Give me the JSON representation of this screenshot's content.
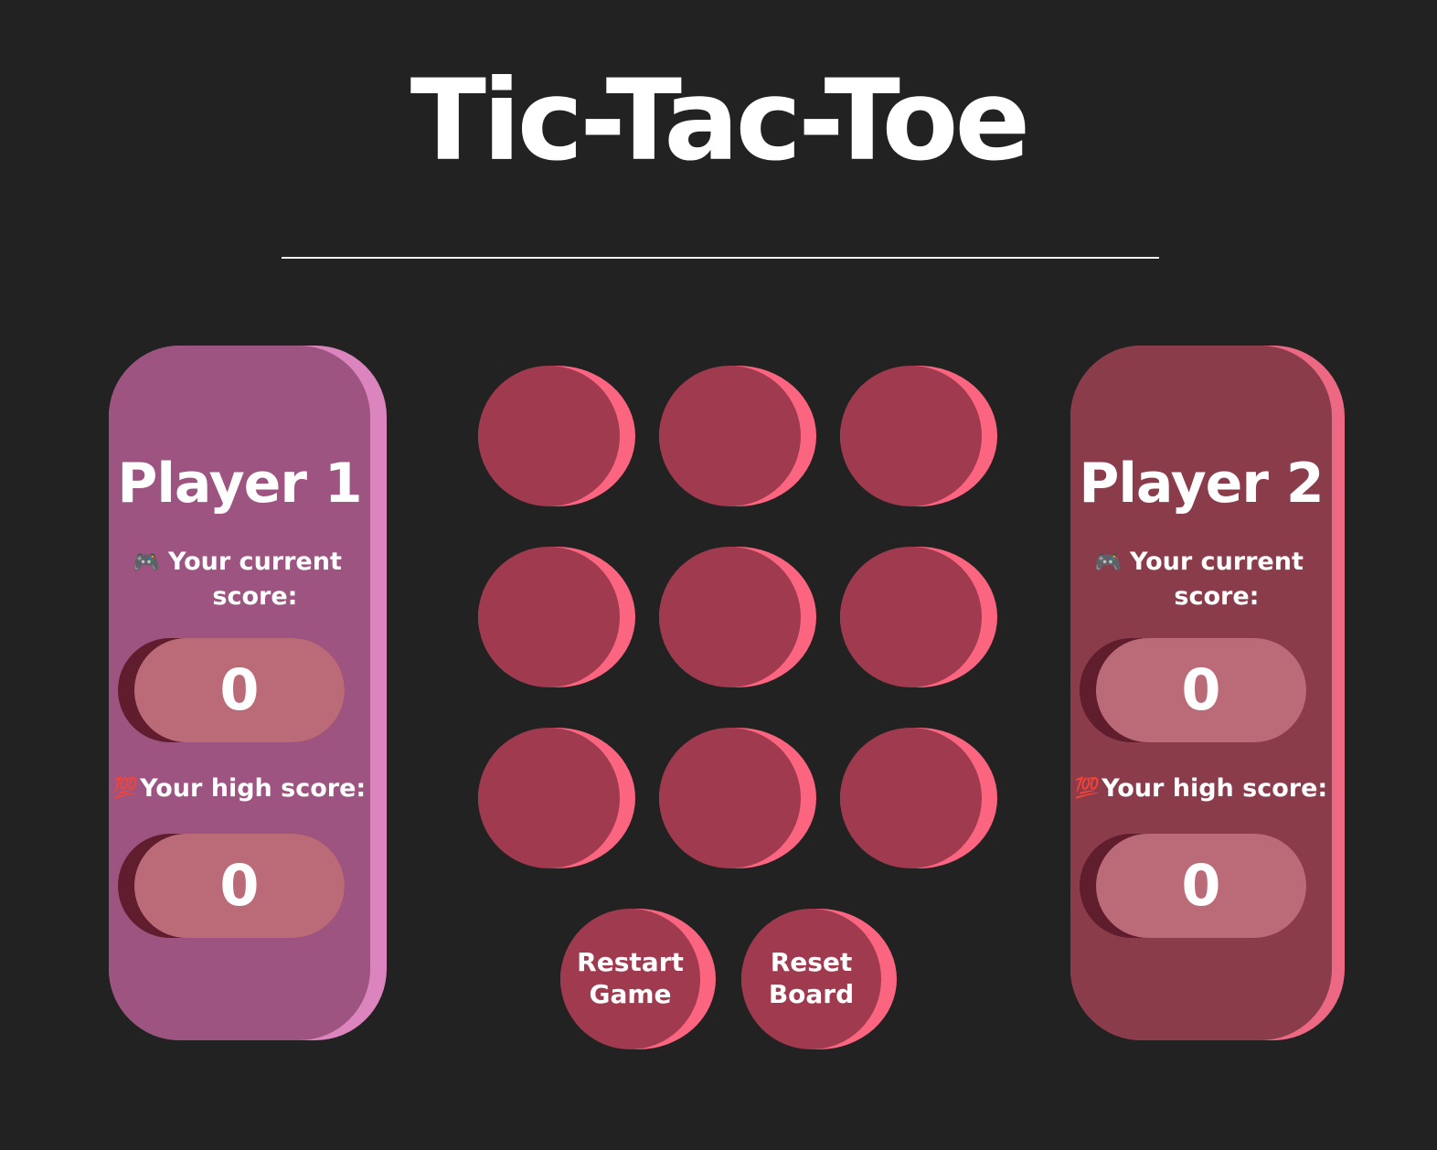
{
  "title": "Tic-Tac-Toe",
  "players": [
    {
      "name": "Player 1",
      "current_score_icon": "video-game-controller-icon",
      "current_score_label": "Your current score:",
      "current_score": "0",
      "high_score_icon": "hundred-points-icon",
      "high_score_label": "Your high score:",
      "high_score": "0",
      "panel_color": "#9d5480",
      "panel_edge_color": "#dc84bd"
    },
    {
      "name": "Player 2",
      "current_score_icon": "video-game-controller-icon",
      "current_score_label": "Your current score:",
      "current_score": "0",
      "high_score_icon": "hundred-points-icon",
      "high_score_label": "Your high score:",
      "high_score": "0",
      "panel_color": "#8b3c4b",
      "panel_edge_color": "#ec6883"
    }
  ],
  "board": {
    "cells": [
      "",
      "",
      "",
      "",
      "",
      "",
      "",
      "",
      ""
    ],
    "cell_color": "#a03a4f",
    "cell_edge_color": "#fc6580"
  },
  "actions": {
    "restart_label": "Restart Game",
    "reset_label": "Reset Board"
  },
  "colors": {
    "background": "#222222",
    "score_pill": "#bb6b78",
    "score_pill_shadow": "#5f1d2d"
  }
}
